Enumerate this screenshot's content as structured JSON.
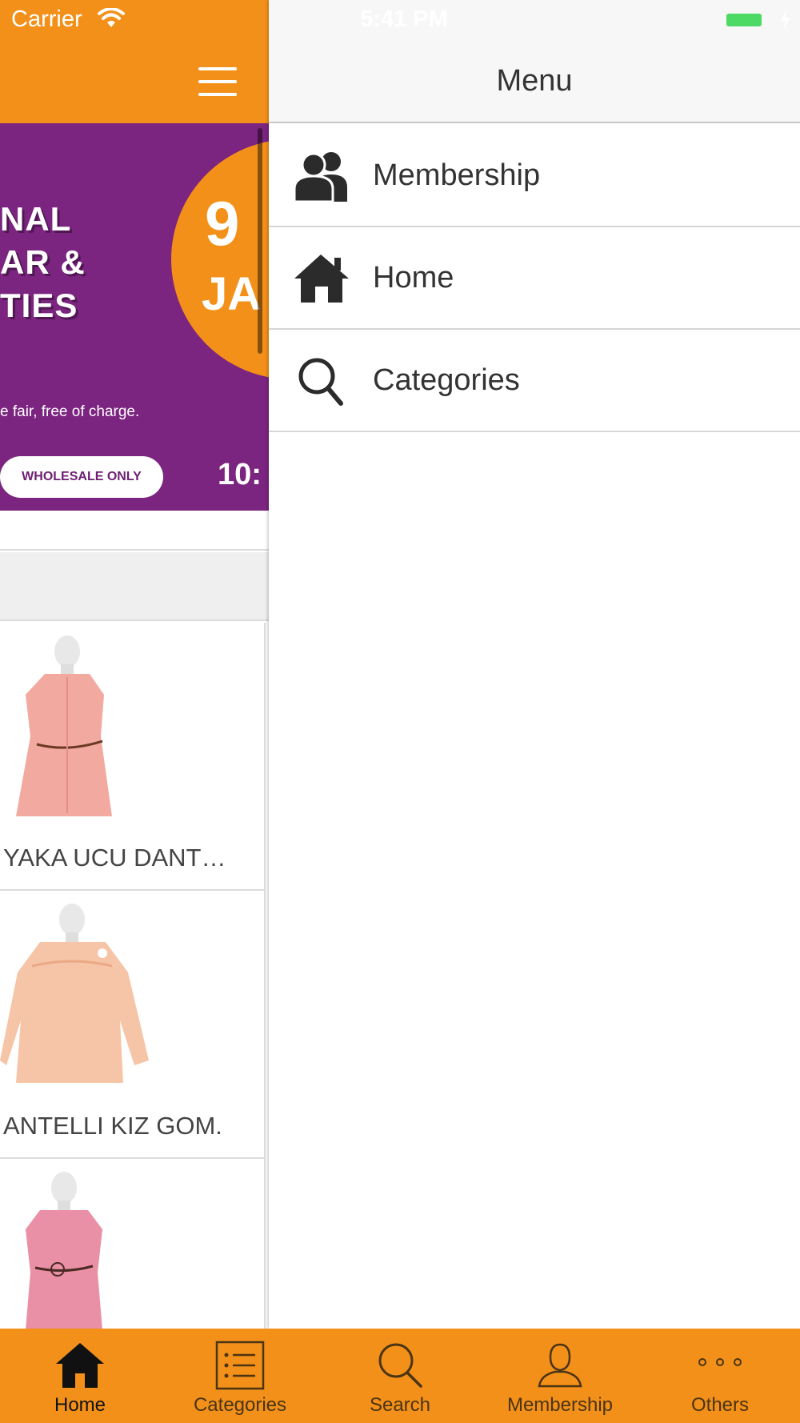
{
  "status_bar": {
    "carrier": "Carrier",
    "time": "5:41 PM"
  },
  "banner": {
    "lines": [
      "NAL",
      "AR &",
      "TIES"
    ],
    "subtitle": "e fair, free of charge.",
    "circle_number": "9",
    "circle_month": "JA",
    "pill_label": "WHOLESALE ONLY",
    "time_text": "10:"
  },
  "products": [
    {
      "name": "YAKA UCU DANT…",
      "color": "#f2a99f",
      "icon": "dress-icon"
    },
    {
      "name": "ANTELLI KIZ GOM.",
      "color": "#f6c4a6",
      "icon": "blouse-icon"
    },
    {
      "name": "",
      "color": "#e98fa6",
      "icon": "dress-icon"
    }
  ],
  "drawer": {
    "title": "Menu",
    "items": [
      {
        "label": "Membership",
        "icon": "users-icon"
      },
      {
        "label": "Home",
        "icon": "home-icon"
      },
      {
        "label": "Categories",
        "icon": "search-icon"
      }
    ]
  },
  "tab_bar": {
    "tabs": [
      {
        "label": "Home",
        "icon": "home-icon",
        "active": true
      },
      {
        "label": "Categories",
        "icon": "list-icon",
        "active": false
      },
      {
        "label": "Search",
        "icon": "search-icon",
        "active": false
      },
      {
        "label": "Membership",
        "icon": "person-icon",
        "active": false
      },
      {
        "label": "Others",
        "icon": "more-icon",
        "active": false
      }
    ]
  },
  "colors": {
    "brand_orange": "#f39019",
    "banner_purple": "#7b2480",
    "battery_green": "#4cd964"
  }
}
